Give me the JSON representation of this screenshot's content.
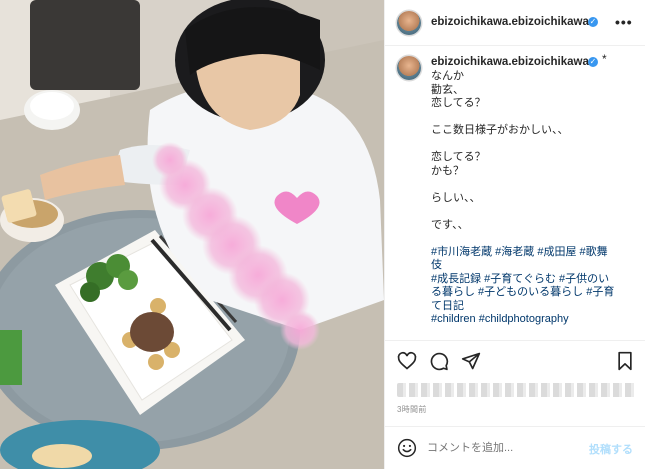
{
  "post": {
    "username": "ebizoichikawa.ebizoichikawa",
    "verified_mark": "✓",
    "more_label": "•••",
    "caption_dot": "*",
    "caption_lines": [
      {
        "text": "なんか",
        "kind": "text"
      },
      {
        "text": "勸玄、",
        "kind": "text"
      },
      {
        "text": "恋してる？",
        "kind": "text"
      },
      {
        "text": "",
        "kind": "text"
      },
      {
        "text": "ここ数日様子がおかしい、、",
        "kind": "text"
      },
      {
        "text": "",
        "kind": "text"
      },
      {
        "text": "恋してる？",
        "kind": "text"
      },
      {
        "text": "かも？",
        "kind": "text"
      },
      {
        "text": "",
        "kind": "text"
      },
      {
        "text": "らしい、、",
        "kind": "text"
      },
      {
        "text": "",
        "kind": "text"
      },
      {
        "text": "です、、",
        "kind": "text"
      },
      {
        "text": "",
        "kind": "text"
      },
      {
        "text": "#市川海老蔵 #海老蔵 #成田屋 #歌舞",
        "kind": "tag"
      },
      {
        "text": "伎",
        "kind": "tag"
      },
      {
        "text": "#成長記録 #子育てぐらむ #子供のい",
        "kind": "tag"
      },
      {
        "text": "る暮らし #子どものいる暮らし #子育",
        "kind": "tag"
      },
      {
        "text": "て日記",
        "kind": "tag"
      },
      {
        "text": "#children #childphotography",
        "kind": "tag"
      }
    ],
    "time_ago": "3時間前"
  },
  "actions": {
    "like_icon": "heart-icon",
    "comment_icon": "comment-icon",
    "share_icon": "paper-plane-icon",
    "save_icon": "bookmark-icon"
  },
  "comment": {
    "placeholder": "コメントを追加...",
    "post_label": "投稿する",
    "emoji_icon": "smiley-icon"
  },
  "colors": {
    "verified": "#3897f0",
    "hashtag": "#00376b",
    "post_button_disabled": "#b2dffc",
    "secondary_text": "#8e8e8e"
  }
}
